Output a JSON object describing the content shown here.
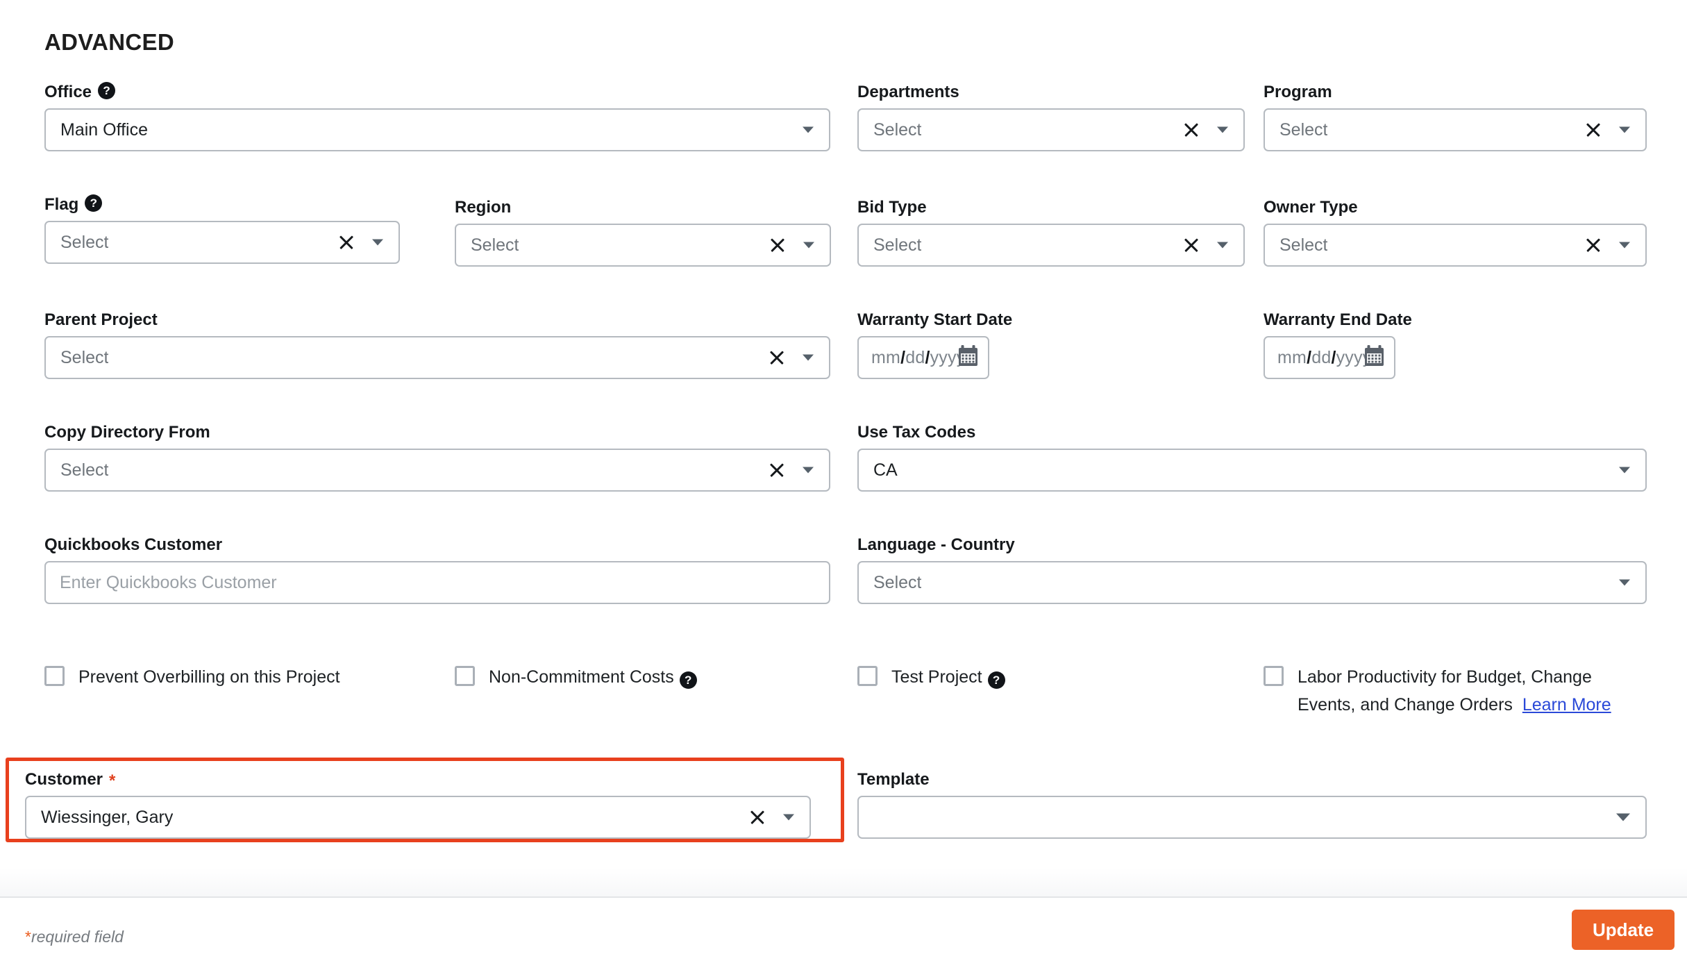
{
  "section": {
    "title": "ADVANCED"
  },
  "fields": {
    "office": {
      "label": "Office",
      "value": "Main Office",
      "help_icon": "question-mark-icon",
      "caret_icon": "chevron-down-icon"
    },
    "departments": {
      "label": "Departments",
      "value": "Select",
      "clear_icon": "close-x-icon",
      "caret_icon": "chevron-down-icon"
    },
    "program": {
      "label": "Program",
      "value": "Select",
      "clear_icon": "close-x-icon",
      "caret_icon": "chevron-down-icon"
    },
    "flag": {
      "label": "Flag",
      "value": "Select",
      "help_icon": "question-mark-icon",
      "clear_icon": "close-x-icon",
      "caret_icon": "chevron-down-icon"
    },
    "region": {
      "label": "Region",
      "value": "Select",
      "clear_icon": "close-x-icon",
      "caret_icon": "chevron-down-icon"
    },
    "bid_type": {
      "label": "Bid Type",
      "value": "Select",
      "clear_icon": "close-x-icon",
      "caret_icon": "chevron-down-icon"
    },
    "owner_type": {
      "label": "Owner Type",
      "value": "Select",
      "clear_icon": "close-x-icon",
      "caret_icon": "chevron-down-icon"
    },
    "parent_project": {
      "label": "Parent Project",
      "value": "Select",
      "clear_icon": "close-x-icon",
      "caret_icon": "chevron-down-icon"
    },
    "warranty_start_date": {
      "label": "Warranty Start Date",
      "mm": "mm",
      "dd": "dd",
      "yyyy": "yyyy",
      "separator": "/",
      "calendar_icon": "calendar-icon"
    },
    "warranty_end_date": {
      "label": "Warranty End Date",
      "mm": "mm",
      "dd": "dd",
      "yyyy": "yyyy",
      "separator": "/",
      "calendar_icon": "calendar-icon"
    },
    "copy_directory_from": {
      "label": "Copy Directory From",
      "value": "Select",
      "clear_icon": "close-x-icon",
      "caret_icon": "chevron-down-icon"
    },
    "use_tax_codes": {
      "label": "Use Tax Codes",
      "value": "CA",
      "caret_icon": "chevron-down-icon"
    },
    "quickbooks_customer": {
      "label": "Quickbooks Customer",
      "value": "",
      "placeholder": "Enter Quickbooks Customer"
    },
    "language_country": {
      "label": "Language - Country",
      "value": "Select",
      "caret_icon": "chevron-down-icon"
    },
    "customer": {
      "label": "Customer",
      "required_marker": "*",
      "value": "Wiessinger, Gary",
      "clear_icon": "close-x-icon",
      "caret_icon": "chevron-down-icon"
    },
    "template": {
      "label": "Template",
      "value": "",
      "caret_icon": "chevron-down-icon"
    }
  },
  "checkboxes": {
    "prevent_overbilling": {
      "label": "Prevent Overbilling on this Project",
      "checked": false
    },
    "non_commitment_costs": {
      "label": "Non-Commitment Costs",
      "checked": false,
      "help_icon": "question-mark-icon"
    },
    "test_project": {
      "label": "Test Project",
      "checked": false,
      "help_icon": "question-mark-icon"
    },
    "labor_productivity": {
      "label": "Labor Productivity for Budget, Change Events, and Change Orders",
      "link_text": "Learn More",
      "checked": false
    }
  },
  "footer": {
    "required_note_star": "*",
    "required_note_text": "required field",
    "update_label": "Update"
  },
  "colors": {
    "accent_orange": "#ec6227",
    "highlight_red": "#e8401d",
    "link_blue": "#2a49d8",
    "border_gray": "#b5bac0"
  }
}
